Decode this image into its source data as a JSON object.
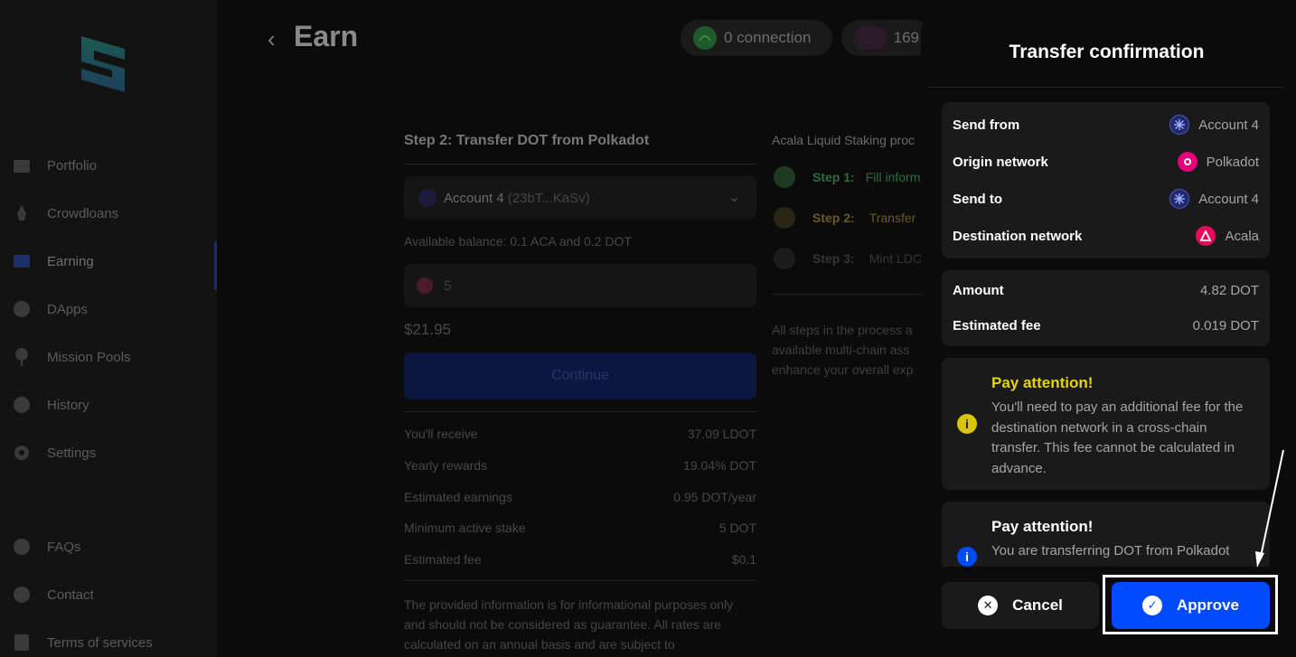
{
  "sidebar": {
    "items": [
      {
        "label": "Portfolio",
        "icon": "wallet-icon"
      },
      {
        "label": "Crowdloans",
        "icon": "rocket-icon"
      },
      {
        "label": "Earning",
        "icon": "earning-icon"
      },
      {
        "label": "DApps",
        "icon": "globe-icon"
      },
      {
        "label": "Mission Pools",
        "icon": "balloon-icon"
      },
      {
        "label": "History",
        "icon": "clock-icon"
      },
      {
        "label": "Settings",
        "icon": "gear-icon"
      },
      {
        "label": "FAQs",
        "icon": "info-icon"
      },
      {
        "label": "Contact",
        "icon": "chat-icon"
      },
      {
        "label": "Terms of services",
        "icon": "document-icon"
      }
    ],
    "active": "Earning"
  },
  "header": {
    "back_icon": "chevron-left-icon",
    "title": "Earn",
    "connection": "0 connection",
    "account_badge": "169"
  },
  "transfer": {
    "title": "Step 2: Transfer DOT from Polkadot",
    "account_name": "Account 4",
    "account_addr": "(23bT...KaSv)",
    "available": "Available balance: 0.1 ACA and 0.2 DOT",
    "amount_value": "5",
    "usd_value": "$21.95",
    "continue_label": "Continue",
    "info": [
      {
        "label": "You'll receive",
        "value": "37.09 LDOT"
      },
      {
        "label": "Yearly rewards",
        "value": "19.04% DOT"
      },
      {
        "label": "Estimated earnings",
        "value": "0.95 DOT/year"
      },
      {
        "label": "Minimum active stake",
        "value": "5 DOT"
      },
      {
        "label": "Estimated fee",
        "value": "$0.1"
      }
    ],
    "disclaimer": "The provided information is for informational purposes only and should not be considered as guarantee. All rates are calculated on an annual basis and are subject to"
  },
  "process": {
    "title": "Acala Liquid Staking proc",
    "steps": [
      {
        "num": "Step 1:",
        "text": "Fill inform"
      },
      {
        "num": "Step 2:",
        "text": "Transfer"
      },
      {
        "num": "Step 3:",
        "text": "Mint LDO"
      }
    ],
    "note": "All steps in the process a available multi-chain ass enhance your overall exp"
  },
  "modal": {
    "title": "Transfer confirmation",
    "details": [
      {
        "label": "Send from",
        "value": "Account 4",
        "icon": "account-icon"
      },
      {
        "label": "Origin network",
        "value": "Polkadot",
        "icon": "polkadot-icon"
      },
      {
        "label": "Send to",
        "value": "Account 4",
        "icon": "account-icon"
      },
      {
        "label": "Destination network",
        "value": "Acala",
        "icon": "acala-icon"
      }
    ],
    "amounts": [
      {
        "label": "Amount",
        "value": "4.82 DOT"
      },
      {
        "label": "Estimated fee",
        "value": "0.019 DOT"
      }
    ],
    "warning1": {
      "title": "Pay attention!",
      "text": "You'll need to pay an additional fee for the destination network in a cross-chain transfer. This fee cannot be calculated in advance."
    },
    "warning2": {
      "title": "Pay attention!",
      "text": "You are transferring DOT from Polkadot"
    },
    "cancel_label": "Cancel",
    "approve_label": "Approve"
  },
  "colors": {
    "accent": "#004BFF",
    "warning": "#D9C500",
    "polkadot": "#E6007A",
    "acala": "#E40C5B"
  }
}
